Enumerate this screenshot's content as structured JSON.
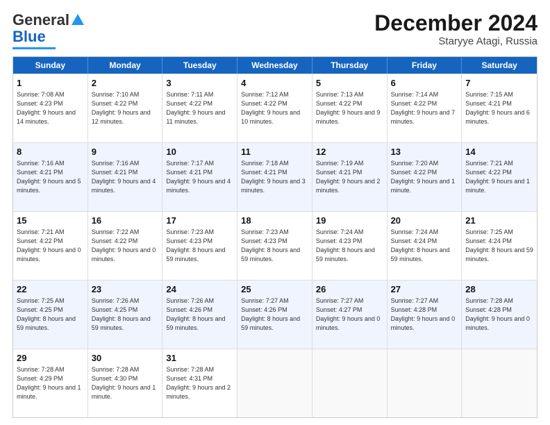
{
  "header": {
    "logo_general": "General",
    "logo_blue": "Blue",
    "title": "December 2024",
    "subtitle": "Staryye Atagi, Russia"
  },
  "calendar": {
    "days_of_week": [
      "Sunday",
      "Monday",
      "Tuesday",
      "Wednesday",
      "Thursday",
      "Friday",
      "Saturday"
    ],
    "weeks": [
      [
        {
          "day": "",
          "sunrise": "",
          "sunset": "",
          "daylight": "",
          "empty": true
        },
        {
          "day": "2",
          "sunrise": "Sunrise: 7:10 AM",
          "sunset": "Sunset: 4:22 PM",
          "daylight": "Daylight: 9 hours and 12 minutes.",
          "empty": false
        },
        {
          "day": "3",
          "sunrise": "Sunrise: 7:11 AM",
          "sunset": "Sunset: 4:22 PM",
          "daylight": "Daylight: 9 hours and 11 minutes.",
          "empty": false
        },
        {
          "day": "4",
          "sunrise": "Sunrise: 7:12 AM",
          "sunset": "Sunset: 4:22 PM",
          "daylight": "Daylight: 9 hours and 10 minutes.",
          "empty": false
        },
        {
          "day": "5",
          "sunrise": "Sunrise: 7:13 AM",
          "sunset": "Sunset: 4:22 PM",
          "daylight": "Daylight: 9 hours and 9 minutes.",
          "empty": false
        },
        {
          "day": "6",
          "sunrise": "Sunrise: 7:14 AM",
          "sunset": "Sunset: 4:22 PM",
          "daylight": "Daylight: 9 hours and 7 minutes.",
          "empty": false
        },
        {
          "day": "7",
          "sunrise": "Sunrise: 7:15 AM",
          "sunset": "Sunset: 4:21 PM",
          "daylight": "Daylight: 9 hours and 6 minutes.",
          "empty": false
        }
      ],
      [
        {
          "day": "8",
          "sunrise": "Sunrise: 7:16 AM",
          "sunset": "Sunset: 4:21 PM",
          "daylight": "Daylight: 9 hours and 5 minutes.",
          "empty": false
        },
        {
          "day": "9",
          "sunrise": "Sunrise: 7:16 AM",
          "sunset": "Sunset: 4:21 PM",
          "daylight": "Daylight: 9 hours and 4 minutes.",
          "empty": false
        },
        {
          "day": "10",
          "sunrise": "Sunrise: 7:17 AM",
          "sunset": "Sunset: 4:21 PM",
          "daylight": "Daylight: 9 hours and 4 minutes.",
          "empty": false
        },
        {
          "day": "11",
          "sunrise": "Sunrise: 7:18 AM",
          "sunset": "Sunset: 4:21 PM",
          "daylight": "Daylight: 9 hours and 3 minutes.",
          "empty": false
        },
        {
          "day": "12",
          "sunrise": "Sunrise: 7:19 AM",
          "sunset": "Sunset: 4:21 PM",
          "daylight": "Daylight: 9 hours and 2 minutes.",
          "empty": false
        },
        {
          "day": "13",
          "sunrise": "Sunrise: 7:20 AM",
          "sunset": "Sunset: 4:22 PM",
          "daylight": "Daylight: 9 hours and 1 minute.",
          "empty": false
        },
        {
          "day": "14",
          "sunrise": "Sunrise: 7:21 AM",
          "sunset": "Sunset: 4:22 PM",
          "daylight": "Daylight: 9 hours and 1 minute.",
          "empty": false
        }
      ],
      [
        {
          "day": "15",
          "sunrise": "Sunrise: 7:21 AM",
          "sunset": "Sunset: 4:22 PM",
          "daylight": "Daylight: 9 hours and 0 minutes.",
          "empty": false
        },
        {
          "day": "16",
          "sunrise": "Sunrise: 7:22 AM",
          "sunset": "Sunset: 4:22 PM",
          "daylight": "Daylight: 9 hours and 0 minutes.",
          "empty": false
        },
        {
          "day": "17",
          "sunrise": "Sunrise: 7:23 AM",
          "sunset": "Sunset: 4:23 PM",
          "daylight": "Daylight: 8 hours and 59 minutes.",
          "empty": false
        },
        {
          "day": "18",
          "sunrise": "Sunrise: 7:23 AM",
          "sunset": "Sunset: 4:23 PM",
          "daylight": "Daylight: 8 hours and 59 minutes.",
          "empty": false
        },
        {
          "day": "19",
          "sunrise": "Sunrise: 7:24 AM",
          "sunset": "Sunset: 4:23 PM",
          "daylight": "Daylight: 8 hours and 59 minutes.",
          "empty": false
        },
        {
          "day": "20",
          "sunrise": "Sunrise: 7:24 AM",
          "sunset": "Sunset: 4:24 PM",
          "daylight": "Daylight: 8 hours and 59 minutes.",
          "empty": false
        },
        {
          "day": "21",
          "sunrise": "Sunrise: 7:25 AM",
          "sunset": "Sunset: 4:24 PM",
          "daylight": "Daylight: 8 hours and 59 minutes.",
          "empty": false
        }
      ],
      [
        {
          "day": "22",
          "sunrise": "Sunrise: 7:25 AM",
          "sunset": "Sunset: 4:25 PM",
          "daylight": "Daylight: 8 hours and 59 minutes.",
          "empty": false
        },
        {
          "day": "23",
          "sunrise": "Sunrise: 7:26 AM",
          "sunset": "Sunset: 4:25 PM",
          "daylight": "Daylight: 8 hours and 59 minutes.",
          "empty": false
        },
        {
          "day": "24",
          "sunrise": "Sunrise: 7:26 AM",
          "sunset": "Sunset: 4:26 PM",
          "daylight": "Daylight: 8 hours and 59 minutes.",
          "empty": false
        },
        {
          "day": "25",
          "sunrise": "Sunrise: 7:27 AM",
          "sunset": "Sunset: 4:26 PM",
          "daylight": "Daylight: 8 hours and 59 minutes.",
          "empty": false
        },
        {
          "day": "26",
          "sunrise": "Sunrise: 7:27 AM",
          "sunset": "Sunset: 4:27 PM",
          "daylight": "Daylight: 9 hours and 0 minutes.",
          "empty": false
        },
        {
          "day": "27",
          "sunrise": "Sunrise: 7:27 AM",
          "sunset": "Sunset: 4:28 PM",
          "daylight": "Daylight: 9 hours and 0 minutes.",
          "empty": false
        },
        {
          "day": "28",
          "sunrise": "Sunrise: 7:28 AM",
          "sunset": "Sunset: 4:28 PM",
          "daylight": "Daylight: 9 hours and 0 minutes.",
          "empty": false
        }
      ],
      [
        {
          "day": "29",
          "sunrise": "Sunrise: 7:28 AM",
          "sunset": "Sunset: 4:29 PM",
          "daylight": "Daylight: 9 hours and 1 minute.",
          "empty": false
        },
        {
          "day": "30",
          "sunrise": "Sunrise: 7:28 AM",
          "sunset": "Sunset: 4:30 PM",
          "daylight": "Daylight: 9 hours and 1 minute.",
          "empty": false
        },
        {
          "day": "31",
          "sunrise": "Sunrise: 7:28 AM",
          "sunset": "Sunset: 4:31 PM",
          "daylight": "Daylight: 9 hours and 2 minutes.",
          "empty": false
        },
        {
          "day": "",
          "sunrise": "",
          "sunset": "",
          "daylight": "",
          "empty": true
        },
        {
          "day": "",
          "sunrise": "",
          "sunset": "",
          "daylight": "",
          "empty": true
        },
        {
          "day": "",
          "sunrise": "",
          "sunset": "",
          "daylight": "",
          "empty": true
        },
        {
          "day": "",
          "sunrise": "",
          "sunset": "",
          "daylight": "",
          "empty": true
        }
      ]
    ],
    "first_day": {
      "day": "1",
      "sunrise": "Sunrise: 7:08 AM",
      "sunset": "Sunset: 4:23 PM",
      "daylight": "Daylight: 9 hours and 14 minutes."
    }
  }
}
